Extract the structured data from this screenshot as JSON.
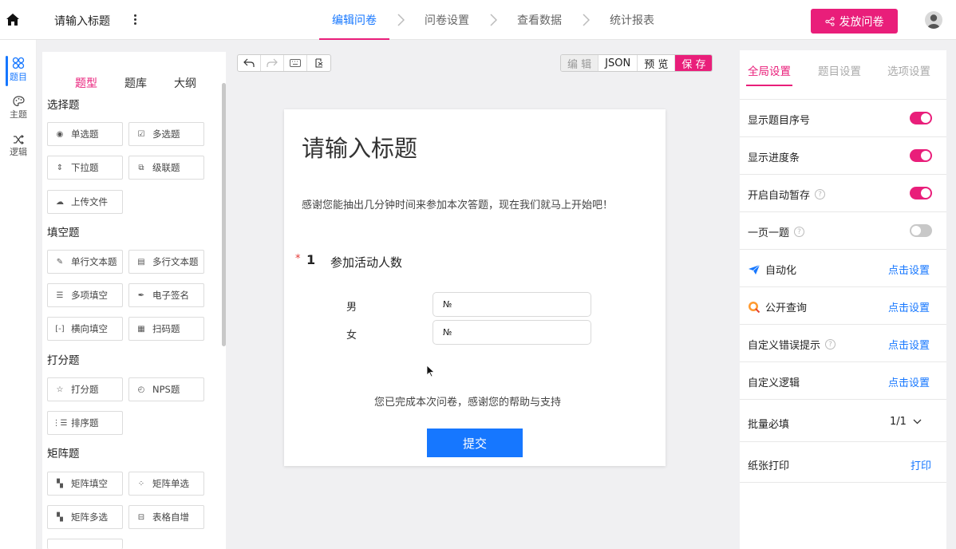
{
  "header": {
    "doc_title": "请输入标题",
    "steps": [
      "编辑问卷",
      "问卷设置",
      "查看数据",
      "统计报表"
    ],
    "publish_label": "发放问卷"
  },
  "rail": [
    {
      "label": "题目",
      "icon": "grid-icon"
    },
    {
      "label": "主题",
      "icon": "palette-icon"
    },
    {
      "label": "逻辑",
      "icon": "shuffle-icon"
    }
  ],
  "panel": {
    "tabs": [
      "题型",
      "题库",
      "大纲"
    ],
    "groups": {
      "choice": {
        "title": "选择题",
        "items": [
          "单选题",
          "多选题",
          "下拉题",
          "级联题",
          "上传文件"
        ]
      },
      "fill": {
        "title": "填空题",
        "items": [
          "单行文本题",
          "多行文本题",
          "多项填空",
          "电子签名",
          "横向填空",
          "扫码题"
        ]
      },
      "score": {
        "title": "打分题",
        "items": [
          "打分题",
          "NPS题",
          "排序题"
        ]
      },
      "matrix": {
        "title": "矩阵题",
        "items": [
          "矩阵填空",
          "矩阵单选",
          "矩阵多选",
          "表格自增"
        ]
      }
    }
  },
  "editor": {
    "modes": [
      "编 辑",
      "JSON",
      "预 览",
      "保 存"
    ]
  },
  "survey": {
    "title": "请输入标题",
    "description": "感谢您能抽出几分钟时间来参加本次答题，现在我们就马上开始吧！",
    "question": {
      "required_mark": "*",
      "number": "1",
      "text": "参加活动人数",
      "options": [
        {
          "label": "男",
          "value": "№"
        },
        {
          "label": "女",
          "value": "№"
        }
      ]
    },
    "finish_text": "您已完成本次问卷，感谢您的帮助与支持",
    "submit_label": "提交"
  },
  "settings": {
    "tabs": [
      "全局设置",
      "题目设置",
      "选项设置"
    ],
    "rows": {
      "show_number": {
        "label": "显示题目序号",
        "on": true
      },
      "show_progress": {
        "label": "显示进度条",
        "on": true
      },
      "auto_save": {
        "label": "开启自动暂存",
        "on": true
      },
      "one_page": {
        "label": "一页一题",
        "on": false
      },
      "automation": {
        "label": "自动化",
        "link": "点击设置"
      },
      "public_query": {
        "label": "公开查询",
        "link": "点击设置"
      },
      "custom_error": {
        "label": "自定义错误提示",
        "link": "点击设置"
      },
      "custom_logic": {
        "label": "自定义逻辑",
        "link": "点击设置"
      },
      "batch_required": {
        "label": "批量必填",
        "value": "1/1"
      },
      "paper_print": {
        "label": "纸张打印",
        "link": "打印"
      }
    },
    "help_glyph": "?"
  },
  "colors": {
    "accent": "#e91e7a",
    "primary": "#1677ff"
  }
}
